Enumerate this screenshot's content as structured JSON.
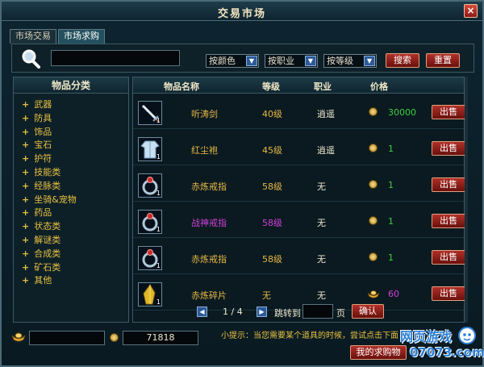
{
  "window": {
    "title": "交易市场",
    "close_label": "×"
  },
  "tabs": [
    {
      "label": "市场交易"
    },
    {
      "label": "市场求购"
    }
  ],
  "search": {
    "input_value": "",
    "color_filter": "按颜色",
    "class_filter": "按职业",
    "level_filter": "按等级",
    "search_button": "搜索",
    "reset_button": "重置"
  },
  "categories": {
    "header": "物品分类",
    "items": [
      "武器",
      "防具",
      "饰品",
      "宝石",
      "护符",
      "技能类",
      "经脉类",
      "坐骑&宠物",
      "药品",
      "状态类",
      "解谜类",
      "合成类",
      "矿石类",
      "其他"
    ]
  },
  "table": {
    "headers": {
      "name": "物品名称",
      "level": "等级",
      "class": "职业",
      "price": "价格"
    },
    "rows": [
      {
        "name": "听涛剑",
        "level": "40级",
        "class": "逍遥",
        "price": "30000",
        "qty": "1",
        "currency": "coin",
        "color": "#e8b848",
        "sell": "出售",
        "icon": "sword-icon"
      },
      {
        "name": "红尘袍",
        "level": "45级",
        "class": "逍遥",
        "price": "1",
        "qty": "1",
        "currency": "coin",
        "color": "#e8b848",
        "sell": "出售",
        "icon": "robe-icon"
      },
      {
        "name": "赤炼戒指",
        "level": "58级",
        "class": "无",
        "price": "1",
        "qty": "1",
        "currency": "coin",
        "color": "#e8b848",
        "sell": "出售",
        "icon": "ring-icon"
      },
      {
        "name": "战神戒指",
        "level": "58级",
        "class": "无",
        "price": "1",
        "qty": "1",
        "currency": "coin",
        "color": "#d040d8",
        "sell": "出售",
        "icon": "ring-icon"
      },
      {
        "name": "赤炼戒指",
        "level": "58级",
        "class": "无",
        "price": "1",
        "qty": "1",
        "currency": "coin",
        "color": "#e8b848",
        "sell": "出售",
        "icon": "ring-icon"
      },
      {
        "name": "赤炼碎片",
        "level": "无",
        "class": "无",
        "price": "60",
        "qty": "1",
        "currency": "gold-ingot",
        "color": "#e8b848",
        "sell": "出售",
        "icon": "crystal-shard-icon"
      }
    ]
  },
  "pager": {
    "page_text": "1 / 4",
    "jump_label": "跳转到",
    "jump_value": "",
    "page_unit": "页",
    "confirm_button": "确认"
  },
  "footer": {
    "gold_value": "",
    "coin_value": "71818",
    "hint": "小提示：当您需要某个道具的时候，尝试点击下面",
    "my_requests_button": "我的求购物"
  },
  "watermark": {
    "line1": "网页游戏",
    "line2": "07073.com"
  },
  "colors": {
    "accent_gold": "#e8c040",
    "price_green": "#40d040",
    "button_red": "#a02820",
    "text_light": "#e8e0c8"
  }
}
